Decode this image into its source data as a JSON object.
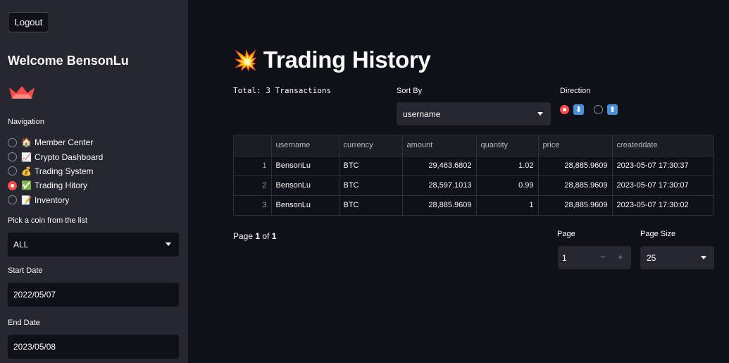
{
  "sidebar": {
    "logout_label": "Logout",
    "welcome": "Welcome BensonLu",
    "nav_label": "Navigation",
    "nav_items": [
      {
        "emoji": "🏠",
        "label": "Member Center",
        "selected": false
      },
      {
        "emoji": "📈",
        "label": "Crypto Dashboard",
        "selected": false
      },
      {
        "emoji": "💰",
        "label": "Trading System",
        "selected": false
      },
      {
        "emoji": "✅",
        "label": "Trading Hitory",
        "selected": true
      },
      {
        "emoji": "📝",
        "label": "Inventory",
        "selected": false
      }
    ],
    "coin_label": "Pick a coin from the list",
    "coin_value": "ALL",
    "start_label": "Start Date",
    "start_value": "2022/05/07",
    "end_label": "End Date",
    "end_value": "2023/05/08"
  },
  "main": {
    "title_icon": "💥",
    "title": "Trading History",
    "total": "Total: 3 Transactions",
    "sort_label": "Sort By",
    "sort_value": "username",
    "direction_label": "Direction",
    "direction_options": [
      {
        "icon": "down-arrow-icon",
        "glyph": "⬇",
        "selected": true
      },
      {
        "icon": "up-arrow-icon",
        "glyph": "⬆",
        "selected": false
      }
    ],
    "table": {
      "columns": [
        "",
        "username",
        "currency",
        "amount",
        "quantity",
        "price",
        "createddate"
      ],
      "rows": [
        [
          "1",
          "BensonLu",
          "BTC",
          "29,463.6802",
          "1.02",
          "28,885.9609",
          "2023-05-07 17:30:37"
        ],
        [
          "2",
          "BensonLu",
          "BTC",
          "28,597.1013",
          "0.99",
          "28,885.9609",
          "2023-05-07 17:30:07"
        ],
        [
          "3",
          "BensonLu",
          "BTC",
          "28,885.9609",
          "1",
          "28,885.9609",
          "2023-05-07 17:30:02"
        ]
      ]
    },
    "page_prefix": "Page ",
    "page_current": "1",
    "page_of": " of ",
    "page_total": "1",
    "page_label": "Page",
    "page_value": "1",
    "page_size_label": "Page Size",
    "page_size_value": "25"
  },
  "colors": {
    "accent": "#ff4b4b",
    "sidebar": "#262730",
    "background": "#0e1117"
  }
}
